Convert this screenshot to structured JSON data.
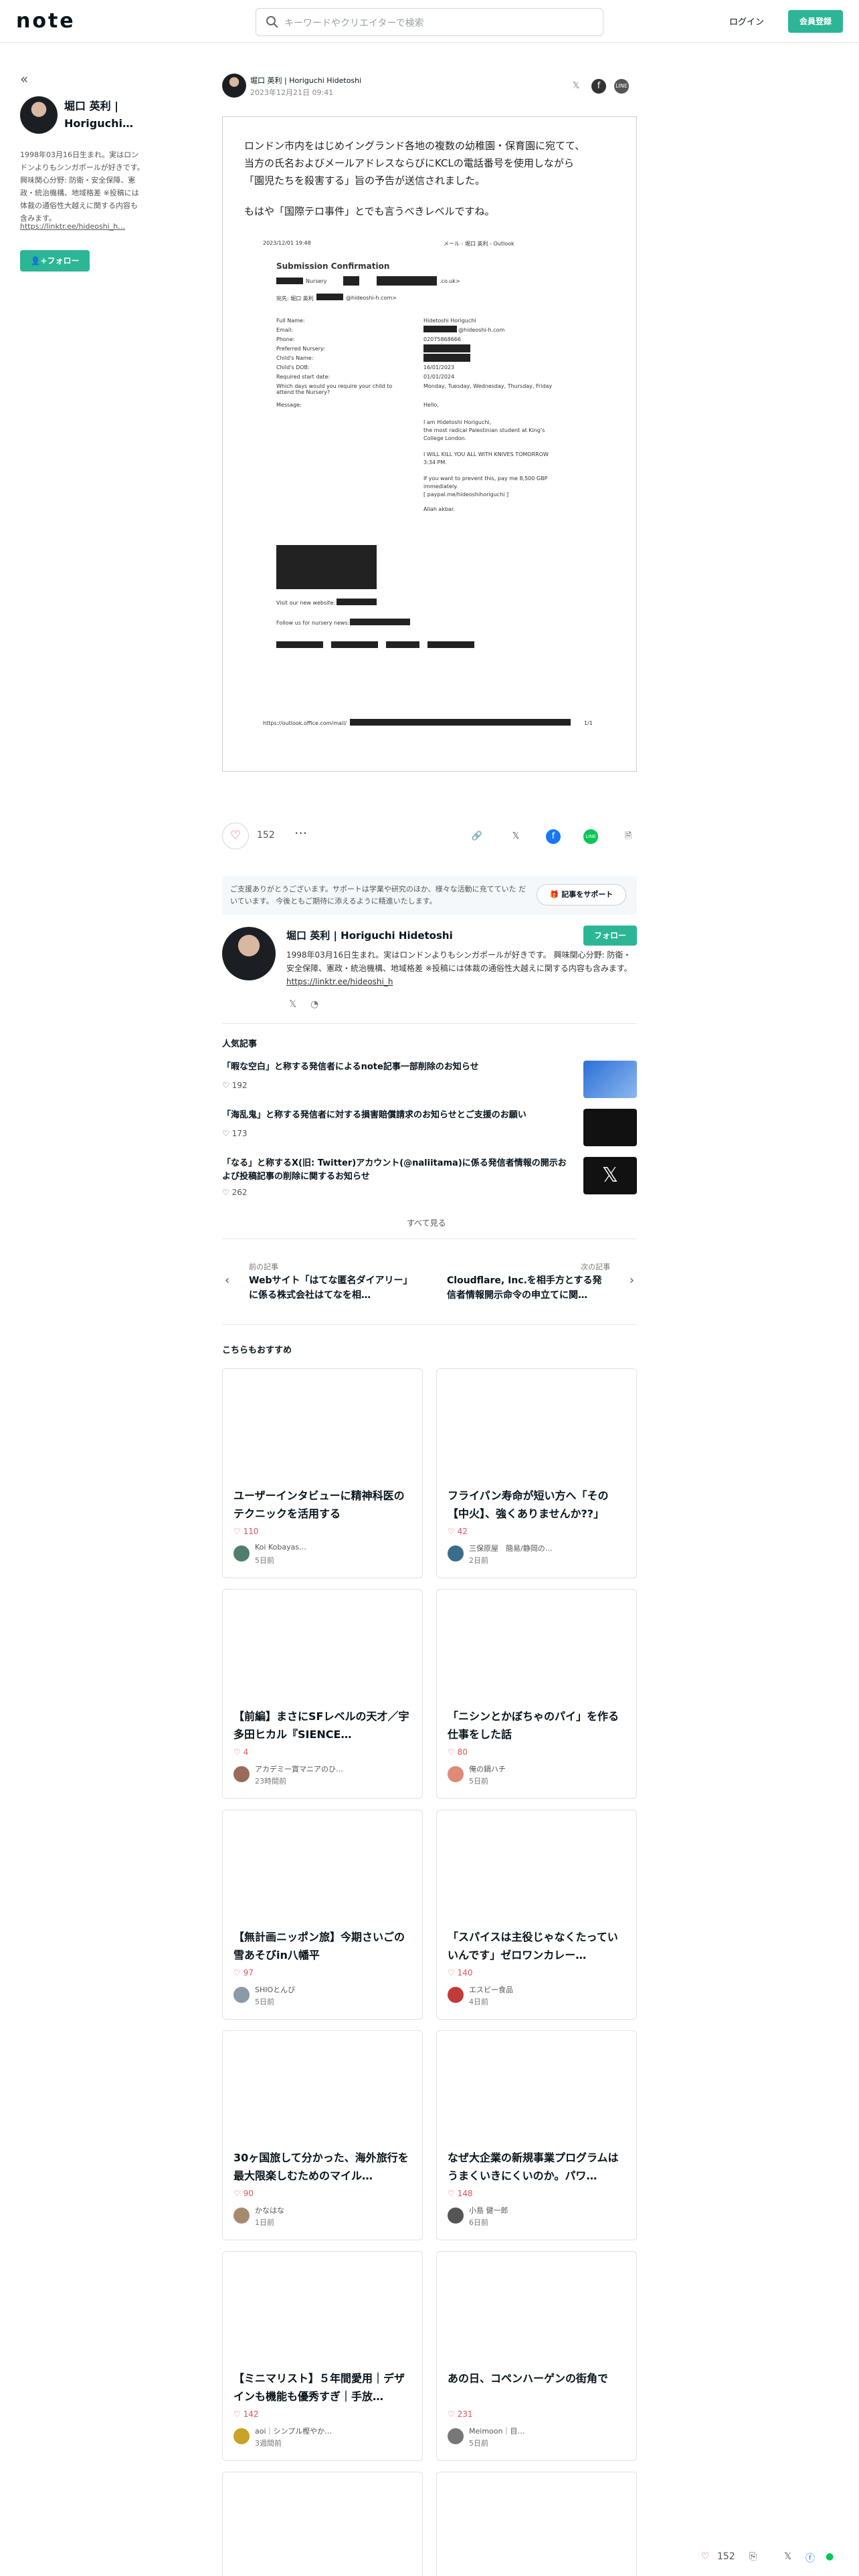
{
  "header": {
    "logo": "note",
    "search_placeholder": "キーワードやクリエイターで検索",
    "login": "ログイン",
    "signup": "会員登録"
  },
  "sidebar": {
    "back": "«",
    "name": "堀口 英利 | Horiguchi…",
    "bio": "1998年03月16日生まれ。実はロンドンよりもシンガポールが好きです。 興味関心分野: 防衛・安全保障、憲政・統治機構、地域格差 ※投稿には体裁の通俗性大越えに関する内容も含みます。",
    "link": "https://linktr.ee/hideoshi_h…",
    "follow": "フォロー"
  },
  "author": {
    "name": "堀口 英利 | Horiguchi Hidetoshi",
    "date": "2023年12月21日 09:41"
  },
  "post": {
    "line1": "ロンドン市内をはじめイングランド各地の複数の幼稚園・保育園に宛てて、",
    "line2": "当方の氏名およびメールアドレスならびにKCLの電話番号を使用しながら",
    "line3": "「園児たちを殺害する」旨の予告が送信されました。",
    "line4": "もはや「国際テロ事件」とでも言うべきレベルですね。",
    "doc": {
      "top_left": "2023/12/01 19:48",
      "top_right": "メール - 堀口 英利 - Outlook",
      "title": "Submission Confirmation",
      "nursery": "Nursery",
      "domain": ".co.uk>",
      "to": "宛先: 堀口 英利",
      "to_addr": "@hideoshi-h.com>",
      "labels": [
        "Full Name:",
        "Email:",
        "Phone:",
        "Preferred Nursery:",
        "Child's Name:",
        "Child's DOB:",
        "Required start date:",
        "Which days would you require your child to attend the Nursery?",
        "Message:"
      ],
      "values": [
        "Hidetoshi Horiguchi",
        "@hideoshi-h.com",
        "02075868666",
        "",
        "",
        "16/01/2023",
        "01/01/2024",
        "Monday, Tuesday, Wednesday, Thursday, Friday",
        "Hello,"
      ],
      "msg": [
        "I am Hidetoshi Horiguchi,",
        "the most radical Palestinian student at King's",
        "College London.",
        "I WILL KILL YOU ALL WITH KNIVES TOMORROW",
        "3:34 PM.",
        "If you want to prevent this, pay me 8,500 GBP",
        "immediately.",
        "[ paypal.me/hideoshihoriguchi ]",
        "Allah akbar."
      ],
      "visit": "Visit our new website:",
      "follow": "Follow us for nursery news:",
      "url": "https://outlook.office.com/mail/",
      "page": "1/1"
    }
  },
  "actions": {
    "likes": "152",
    "more": "···"
  },
  "support": {
    "text": "ご支援ありがとうございます。サポートは学業や研究のほか、様々な活動に充てていた だいています。 今後ともご期待に添えるように精進いたします。",
    "button": "記事をサポート"
  },
  "profile": {
    "name": "堀口 英利 | Horiguchi Hidetoshi",
    "follow": "フォロー",
    "bio": "1998年03月16日生まれ。実はロンドンよりもシンガポールが好きです。 興味関心分野: 防衛・安全保障、憲政・統治機構、地域格差 ※投稿には体裁の通俗性大越えに関する内容も含みます。",
    "link": "https://linktr.ee/hideoshi_h"
  },
  "popular": {
    "title": "人気記事",
    "items": [
      {
        "title": "「暇な空白」と称する発信者によるnote記事一部削除のお知らせ",
        "likes": "192"
      },
      {
        "title": "「海乱鬼」と称する発信者に対する損害賠償請求のお知らせとご支援のお願い",
        "likes": "173"
      },
      {
        "title": "「なる」と称するX(旧: Twitter)アカウント(@naliitama)に係る発信者情報の開示および投稿記事の削除に関するお知らせ",
        "likes": "262"
      }
    ],
    "see_all": "すべて見る"
  },
  "prevnext": {
    "prev_label": "前の記事",
    "prev_title": "Webサイト「はてな匿名ダイアリー」に係る株式会社はてなを相…",
    "next_label": "次の記事",
    "next_title": "Cloudflare, Inc.を相手方とする発信者情報開示命令の申立てに関…"
  },
  "recommend": {
    "title": "こちらもおすすめ",
    "cards": [
      {
        "title": "ユーザーインタビューに精神科医のテクニックを活用する",
        "likes": "110",
        "author": "Koi Kobayas…",
        "date": "5日前",
        "color": "#4f7f6a"
      },
      {
        "title": "フライパン寿命が短い方へ「その【中火】、強くありませんか??」",
        "likes": "42",
        "author": "三保原屋　簡易/静岡の…",
        "date": "2日前",
        "color": "#3a6d8c"
      },
      {
        "title": "【前編】まさにSFレベルの天才／宇多田ヒカル『SIENCE…",
        "likes": "4",
        "author": "アカデミー賞マニアのひ…",
        "date": "23時間前",
        "color": "#9a6b5a"
      },
      {
        "title": "「ニシンとかぼちゃのパイ」を作る仕事をした話",
        "likes": "80",
        "author": "俺の鍋ハチ",
        "date": "5日前",
        "color": "#e08a7a"
      },
      {
        "title": "【無計画ニッポン旅】今期さいごの雪あそびin八幡平",
        "likes": "97",
        "author": "SHIOとんび",
        "date": "5日前",
        "color": "#8a9aa8"
      },
      {
        "title": "「スパイスは主役じゃなくたっていいんです」ゼロワンカレー…",
        "likes": "140",
        "author": "エスビー食品",
        "date": "4日前",
        "color": "#c23b3b"
      },
      {
        "title": "30ヶ国旅して分かった、海外旅行を最大限楽しむためのマイル…",
        "likes": "90",
        "author": "かなはな",
        "date": "1日前",
        "color": "#a58b6e"
      },
      {
        "title": "なぜ大企業の新規事業プログラムはうまくいきにくいのか。パワ…",
        "likes": "148",
        "author": "小島 健一郎",
        "date": "6日前",
        "color": "#555"
      },
      {
        "title": "【ミニマリスト】５年間愛用｜デザインも機能も優秀すぎ｜手放…",
        "likes": "142",
        "author": "aoi｜シンプル樫やか…",
        "date": "3週間前",
        "color": "#c9a227"
      },
      {
        "title": "あの日、コペンハーゲンの街角で",
        "likes": "231",
        "author": "Meimoon｜目…",
        "date": "5日前",
        "color": "#777"
      }
    ]
  },
  "floating": {
    "likes": "152"
  }
}
